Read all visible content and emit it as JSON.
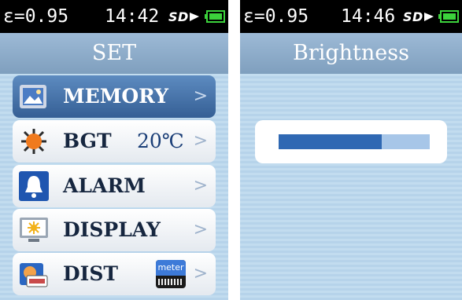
{
  "left": {
    "status": {
      "emissivity": "ε=0.95",
      "time": "14:42"
    },
    "title": "SET",
    "menu": [
      {
        "label": "MEMORY",
        "icon": "memory-icon",
        "selected": true
      },
      {
        "label": "BGT",
        "value": "20℃",
        "icon": "sun-icon"
      },
      {
        "label": "ALARM",
        "icon": "bell-icon"
      },
      {
        "label": "DISPLAY",
        "icon": "display-icon"
      },
      {
        "label": "DIST",
        "icon": "distance-icon",
        "badge": "meter"
      }
    ],
    "chevron": ">"
  },
  "right": {
    "status": {
      "emissivity": "ε=0.95",
      "time": "14:46"
    },
    "title": "Brightness",
    "brightness_level": 0.68
  },
  "colors": {
    "status_bar": "#000000",
    "title_bar": "#8aa9c8",
    "selected_item": "#4574ab",
    "brightness_fill": "#2f68b3",
    "brightness_track": "#a7c6e8",
    "battery": "#3cd23c"
  }
}
